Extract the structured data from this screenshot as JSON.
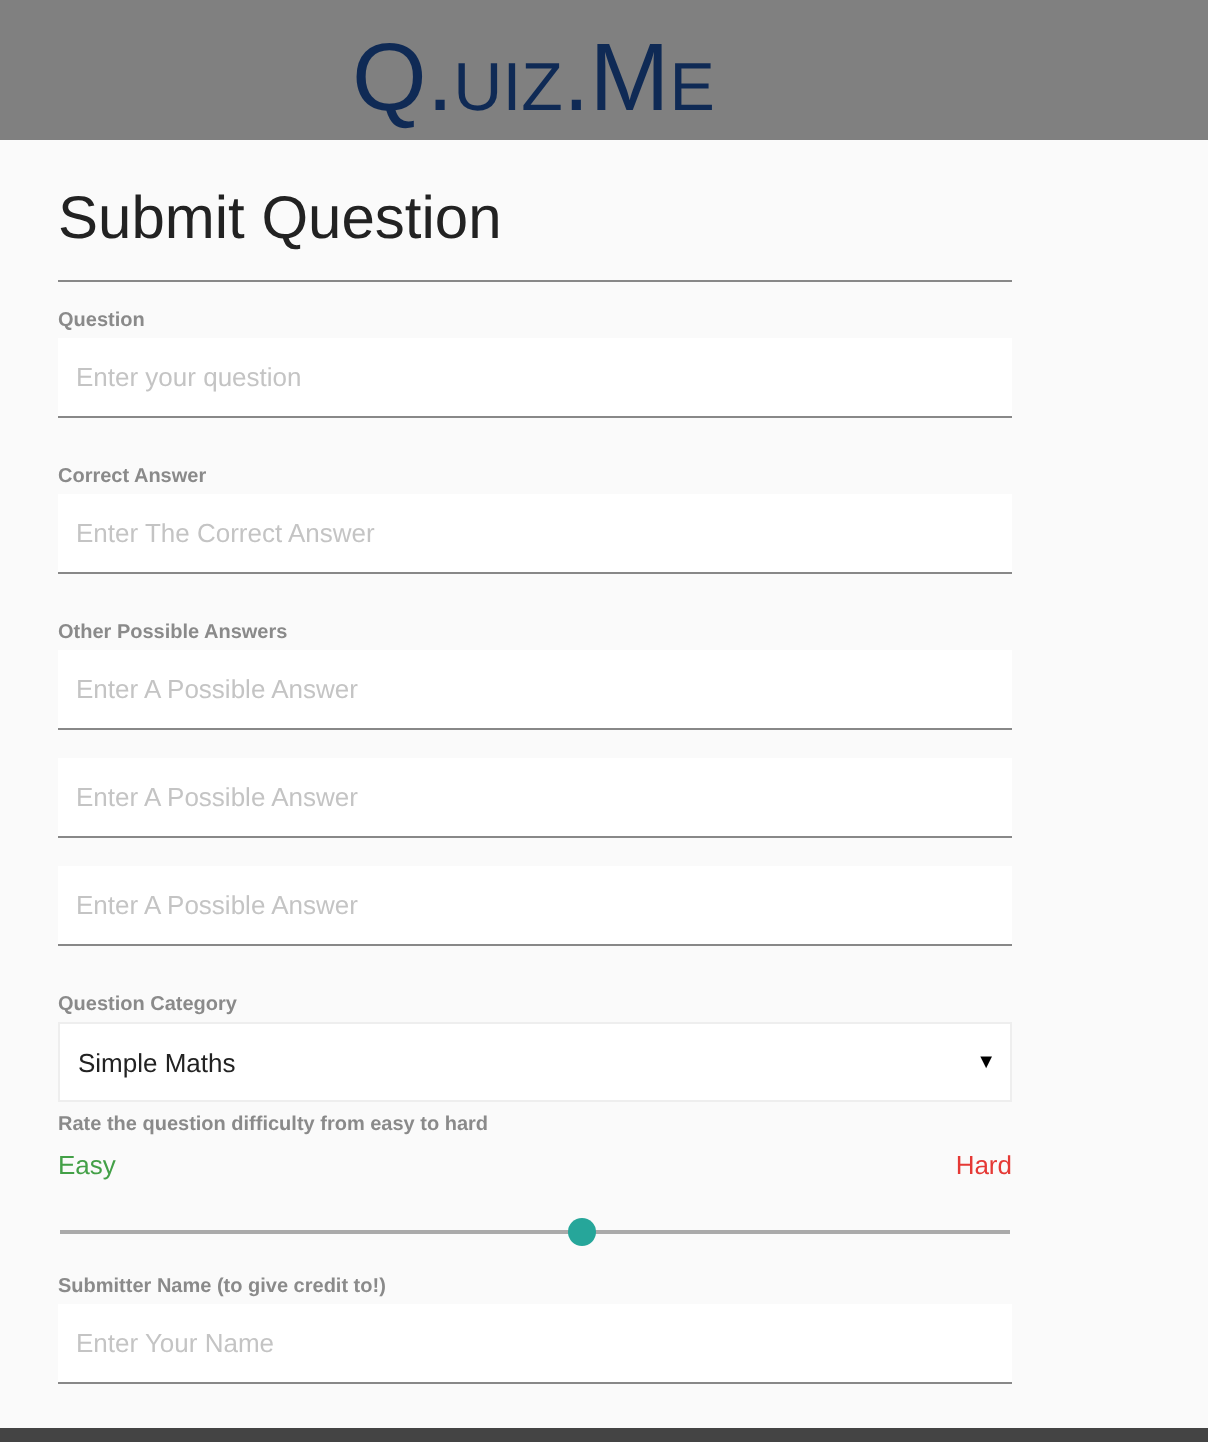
{
  "header": {
    "logo": "Q.uiz.Me"
  },
  "form": {
    "title": "Submit Question",
    "question": {
      "label": "Question",
      "placeholder": "Enter your question"
    },
    "correct_answer": {
      "label": "Correct Answer",
      "placeholder": "Enter The Correct Answer"
    },
    "other_answers": {
      "label": "Other Possible Answers",
      "fields": [
        {
          "placeholder": "Enter A Possible Answer"
        },
        {
          "placeholder": "Enter A Possible Answer"
        },
        {
          "placeholder": "Enter A Possible Answer"
        }
      ]
    },
    "category": {
      "label": "Question Category",
      "value": "Simple Maths",
      "arrow": "▼"
    },
    "difficulty": {
      "label": "Rate the question difficulty from easy to hard",
      "min_label": "Easy",
      "max_label": "Hard",
      "level": 0.55
    },
    "submitter": {
      "label": "Submitter Name (to give credit to!)",
      "placeholder": "Enter Your Name"
    }
  }
}
